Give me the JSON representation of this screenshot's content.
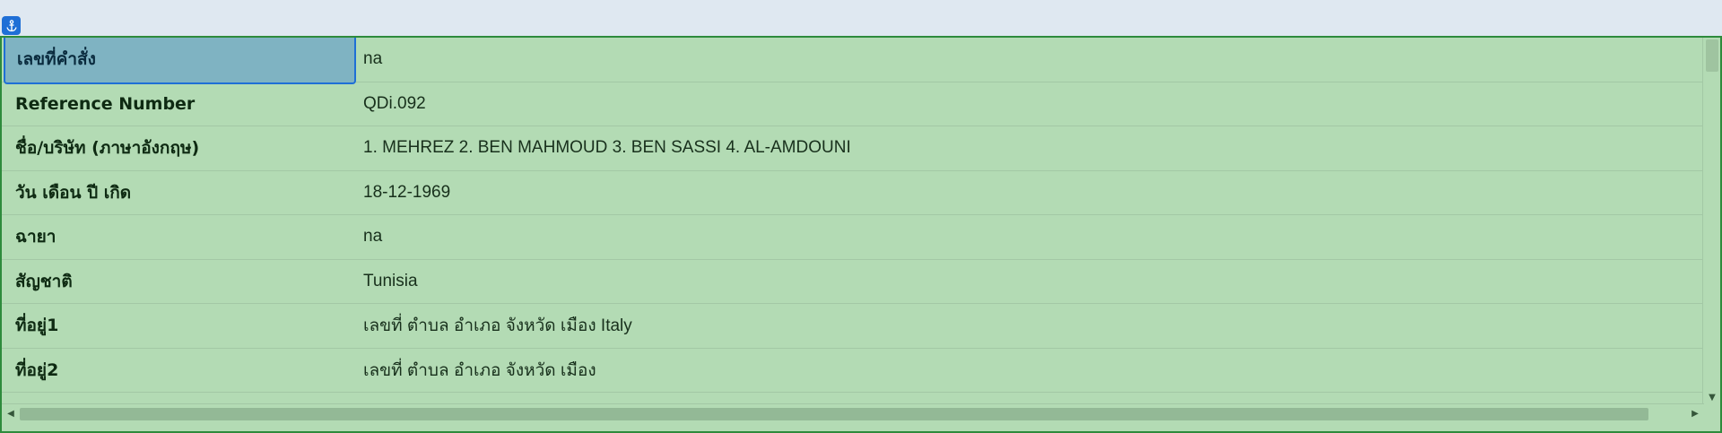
{
  "colors": {
    "panel_background": "#b3dbb4",
    "panel_border": "#2e8b3c",
    "selected_cell": "#7fb3c2",
    "selection_outline": "#1f6fd6",
    "anchor_badge": "#1f6fd6"
  },
  "anchor_icon": "anchor-icon",
  "rows": [
    {
      "label": "เลขที่คำสั่ง",
      "value": "na",
      "selected": true
    },
    {
      "label": "Reference Number",
      "value": "QDi.092"
    },
    {
      "label": "ชื่อ/บริษัท (ภาษาอังกฤษ)",
      "value": "1. MEHREZ 2. BEN MAHMOUD 3. BEN SASSI 4. AL-AMDOUNI"
    },
    {
      "label": "วัน เดือน ปี เกิด",
      "value": "18-12-1969"
    },
    {
      "label": "ฉายา",
      "value": "na"
    },
    {
      "label": "สัญชาติ",
      "value": "Tunisia"
    },
    {
      "label": "ที่อยู่1",
      "value": "เลขที่ ตำบล อำเภอ จังหวัด เมือง Italy"
    },
    {
      "label": "ที่อยู่2",
      "value": "เลขที่ ตำบล อำเภอ จังหวัด เมือง"
    }
  ]
}
